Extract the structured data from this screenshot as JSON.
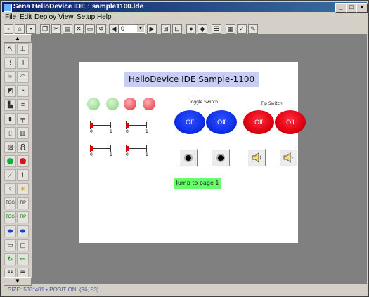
{
  "window": {
    "title": "Sena HelloDevice IDE : sample1100.lde",
    "controls": [
      "_",
      "□",
      "×"
    ]
  },
  "menu": [
    "File",
    "Edit",
    "Deploy",
    "View",
    "Setup",
    "Help"
  ],
  "toolbar": {
    "combo_value": "0"
  },
  "palette": {
    "scroll_up": "▲",
    "scroll_down": "▼",
    "seven_segment_label": "8",
    "tool_badges": [
      "TOG",
      "TIP",
      "TOG",
      "TIP"
    ]
  },
  "canvas": {
    "header": "HelloDevice IDE Sample-1100",
    "toggle_switch_label": "Toggle Switch",
    "tip_switch_label": "Tip Switch",
    "toggle_switches": [
      "Off",
      "Off"
    ],
    "tip_switches": [
      "Off",
      "Off"
    ],
    "slider_min": "0",
    "slider_max": "1",
    "jump_button": "Jump to page 1"
  },
  "status": "SIZE: 533*401 • POSITION: (96, 83)",
  "colors": {
    "led_off_green": "#a8e0a0",
    "led_on_red": "#f06068",
    "toggle_blue": "#1030e8",
    "tip_red": "#e00010",
    "header_bg": "#c8cdf5",
    "jump_bg": "#66ff66"
  }
}
